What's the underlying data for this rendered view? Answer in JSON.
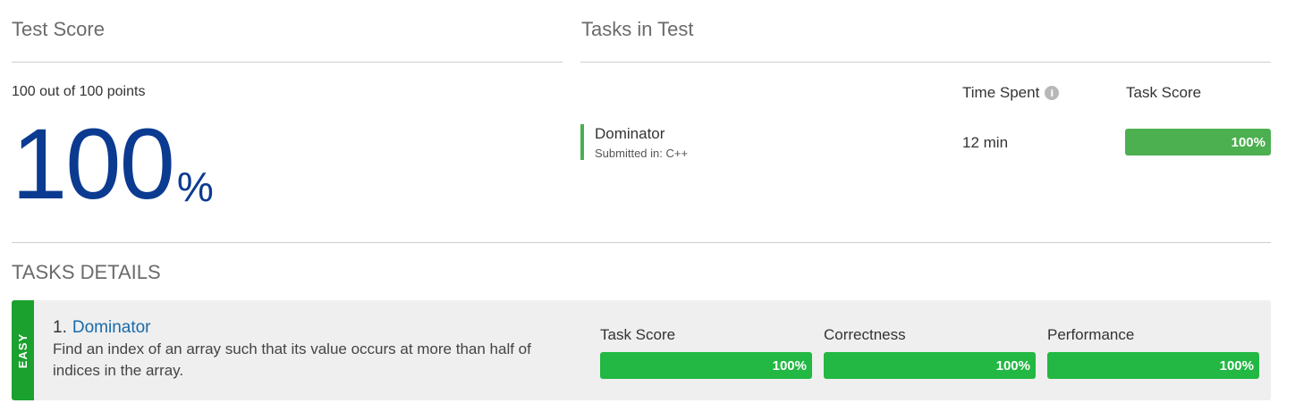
{
  "test_score": {
    "heading": "Test Score",
    "points_text": "100 out of 100 points",
    "percent_value": "100",
    "percent_sign": "%"
  },
  "tasks_in_test": {
    "heading": "Tasks in Test",
    "time_spent_header": "Time Spent",
    "info_icon_glyph": "i",
    "task_score_header": "Task Score",
    "tasks": [
      {
        "name": "Dominator",
        "submitted_in": "Submitted in: C++",
        "time_spent": "12 min",
        "score_label": "100%",
        "score_fraction": 1.0
      }
    ]
  },
  "tasks_details": {
    "heading": "TASKS DETAILS",
    "items": [
      {
        "difficulty": "EASY",
        "number": "1.",
        "name": "Dominator",
        "description": "Find an index of an array such that its value occurs at more than half of indices in the array.",
        "metrics": [
          {
            "label": "Task Score",
            "value_label": "100%",
            "fraction": 1.0
          },
          {
            "label": "Correctness",
            "value_label": "100%",
            "fraction": 1.0
          },
          {
            "label": "Performance",
            "value_label": "100%",
            "fraction": 1.0
          }
        ]
      }
    ]
  },
  "colors": {
    "score_blue": "#0b3b91",
    "bar_green_light": "#4caf50",
    "bar_green_strong": "#22b843",
    "easy_green": "#1aa12e",
    "link_blue": "#1a6aa8"
  }
}
